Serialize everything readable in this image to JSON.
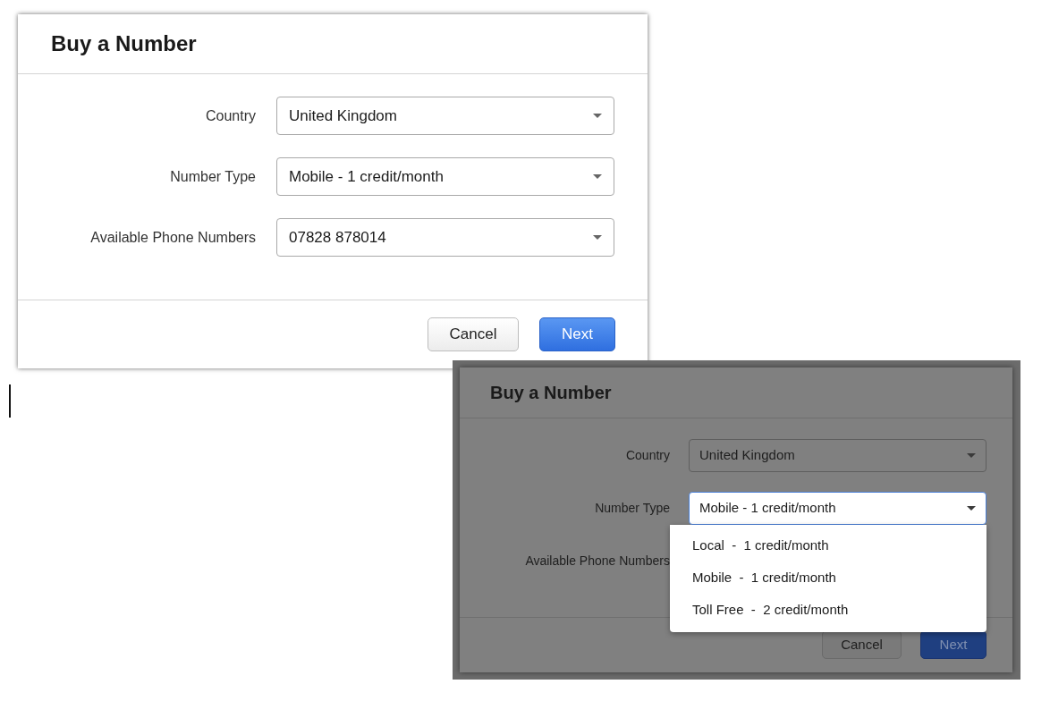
{
  "dialogs": [
    {
      "title": "Buy a Number",
      "dimmed": false,
      "fields": [
        {
          "label": "Country",
          "value": "United Kingdom",
          "expanded": false
        },
        {
          "label": "Number Type",
          "value": "Mobile - 1 credit/month",
          "expanded": false
        },
        {
          "label": "Available Phone Numbers",
          "value": "07828 878014",
          "expanded": false
        }
      ],
      "buttons": [
        {
          "label": "Cancel",
          "kind": "secondary"
        },
        {
          "label": "Next",
          "kind": "primary"
        }
      ]
    },
    {
      "title": "Buy a Number",
      "dimmed": true,
      "fields": [
        {
          "label": "Country",
          "value": "United Kingdom",
          "expanded": false
        },
        {
          "label": "Number Type",
          "value": "Mobile - 1 credit/month",
          "expanded": true,
          "options": [
            "Local  -  1 credit/month",
            "Mobile  -  1 credit/month",
            "Toll Free  -  2 credit/month"
          ]
        },
        {
          "label": "Available Phone Numbers",
          "expanded": false
        }
      ],
      "buttons": [
        {
          "label": "Cancel",
          "kind": "secondary"
        },
        {
          "label": "Next",
          "kind": "primary"
        }
      ]
    }
  ]
}
